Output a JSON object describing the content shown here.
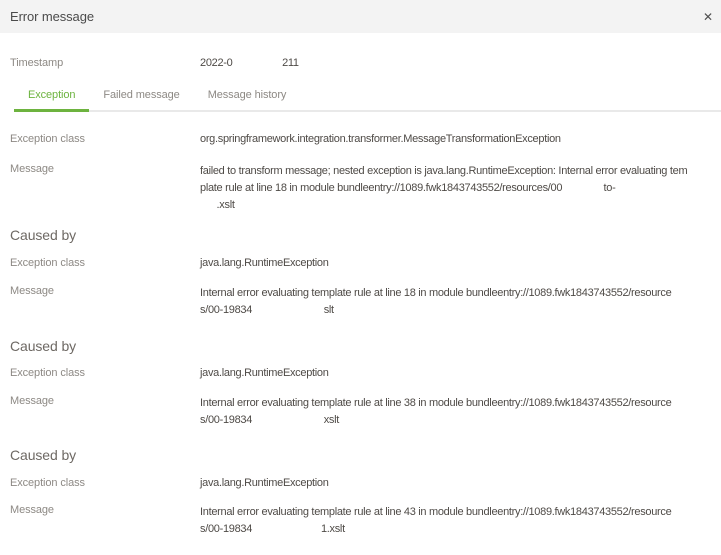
{
  "header": {
    "title": "Error message"
  },
  "icons": {
    "close": "✕"
  },
  "timestamp": {
    "label": "Timestamp",
    "value": "2022-0                  211"
  },
  "tabs": [
    {
      "label": "Exception",
      "active": true
    },
    {
      "label": "Failed message",
      "active": false
    },
    {
      "label": "Message history",
      "active": false
    }
  ],
  "field_labels": {
    "exception_class": "Exception class",
    "message": "Message",
    "caused_by": "Caused by"
  },
  "exception": {
    "exception_class": "org.springframework.integration.transformer.MessageTransformationException",
    "message_lines": [
      "failed to transform message; nested exception is java.lang.RuntimeException: Internal error evaluating tem",
      "plate rule at line 18 in module bundleentry://1089.fwk1843743552/resources/00               to-",
      "      .xslt"
    ]
  },
  "caused_by": [
    {
      "exception_class": "java.lang.RuntimeException",
      "message_lines": [
        "Internal error evaluating template rule at line 18 in module bundleentry://1089.fwk1843743552/resource",
        "s/00-19834                          slt"
      ]
    },
    {
      "exception_class": "java.lang.RuntimeException",
      "message_lines": [
        "Internal error evaluating template rule at line 38 in module bundleentry://1089.fwk1843743552/resource",
        "s/00-19834                          xslt"
      ]
    },
    {
      "exception_class": "java.lang.RuntimeException",
      "message_lines": [
        "Internal error evaluating template rule at line 43 in module bundleentry://1089.fwk1843743552/resource",
        "s/00-19834                         1.xslt"
      ]
    }
  ],
  "colors": {
    "accent_green": "#6db33f",
    "header_bg": "#f3f3f3",
    "label_gray": "#8d8984",
    "text_dark": "#4e4a46"
  }
}
